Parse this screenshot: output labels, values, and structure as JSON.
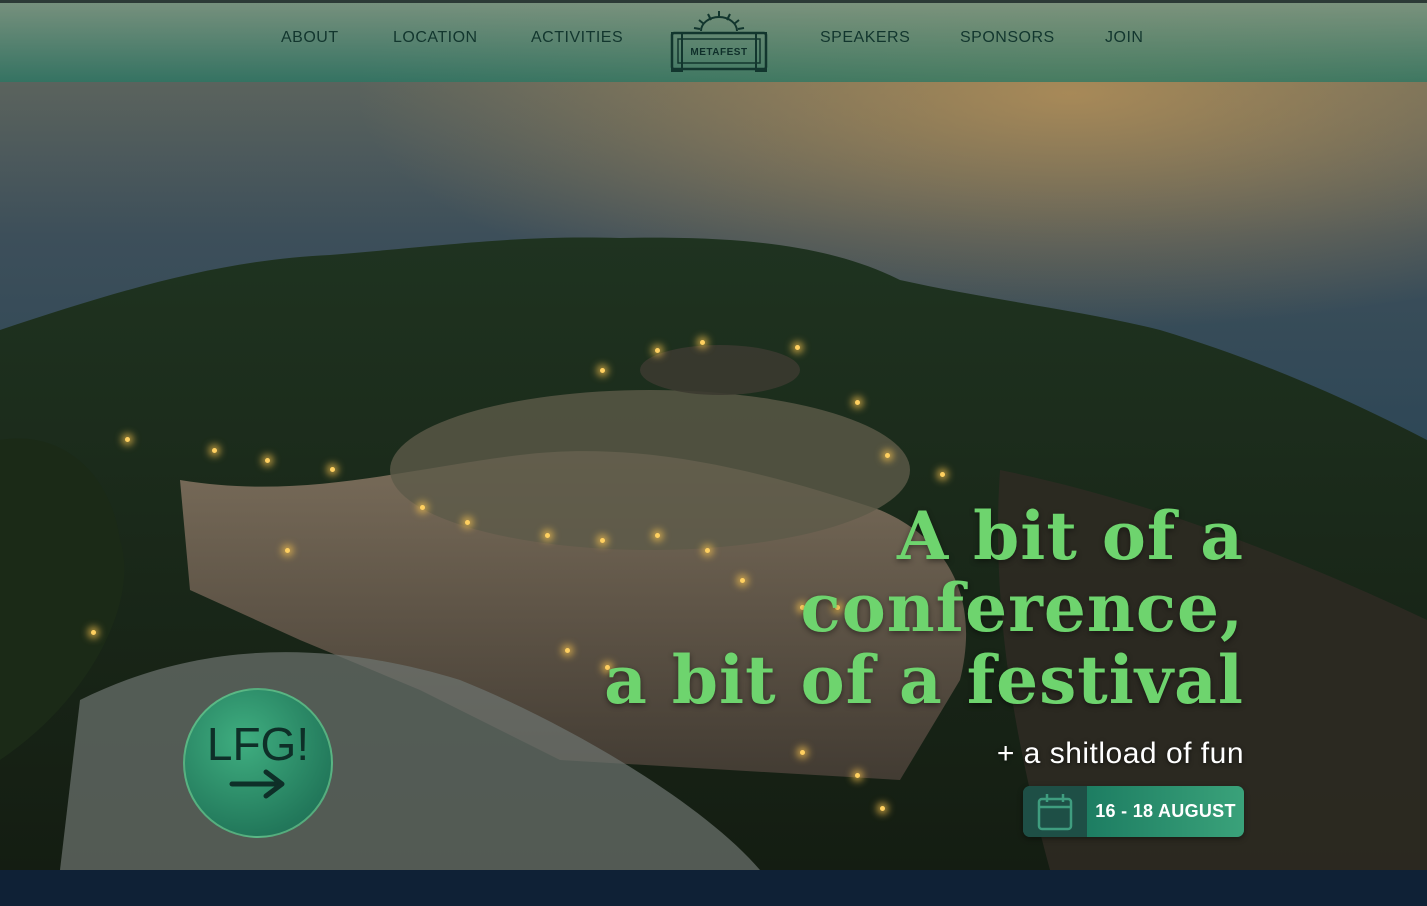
{
  "nav": {
    "left_items": [
      {
        "label": "ABOUT"
      },
      {
        "label": "LOCATION"
      },
      {
        "label": "ACTIVITIES"
      }
    ],
    "right_items": [
      {
        "label": "SPEAKERS"
      },
      {
        "label": "SPONSORS"
      },
      {
        "label": "JOIN"
      }
    ],
    "logo_text": "METAFEST"
  },
  "hero": {
    "headline_lines": [
      "A bit of a",
      "conference,",
      "a bit of a festival"
    ],
    "subline": "+ a shitload of fun",
    "date": "16 - 18 AUGUST",
    "cta_label": "LFG!",
    "cta_icon": "arrow-right-icon",
    "date_icon": "calendar-icon"
  },
  "colors": {
    "accent_green": "#6ed46e",
    "nav_bar": "#3c8a74",
    "cta_circle": "#2f9470",
    "footer": "#0f2136"
  }
}
